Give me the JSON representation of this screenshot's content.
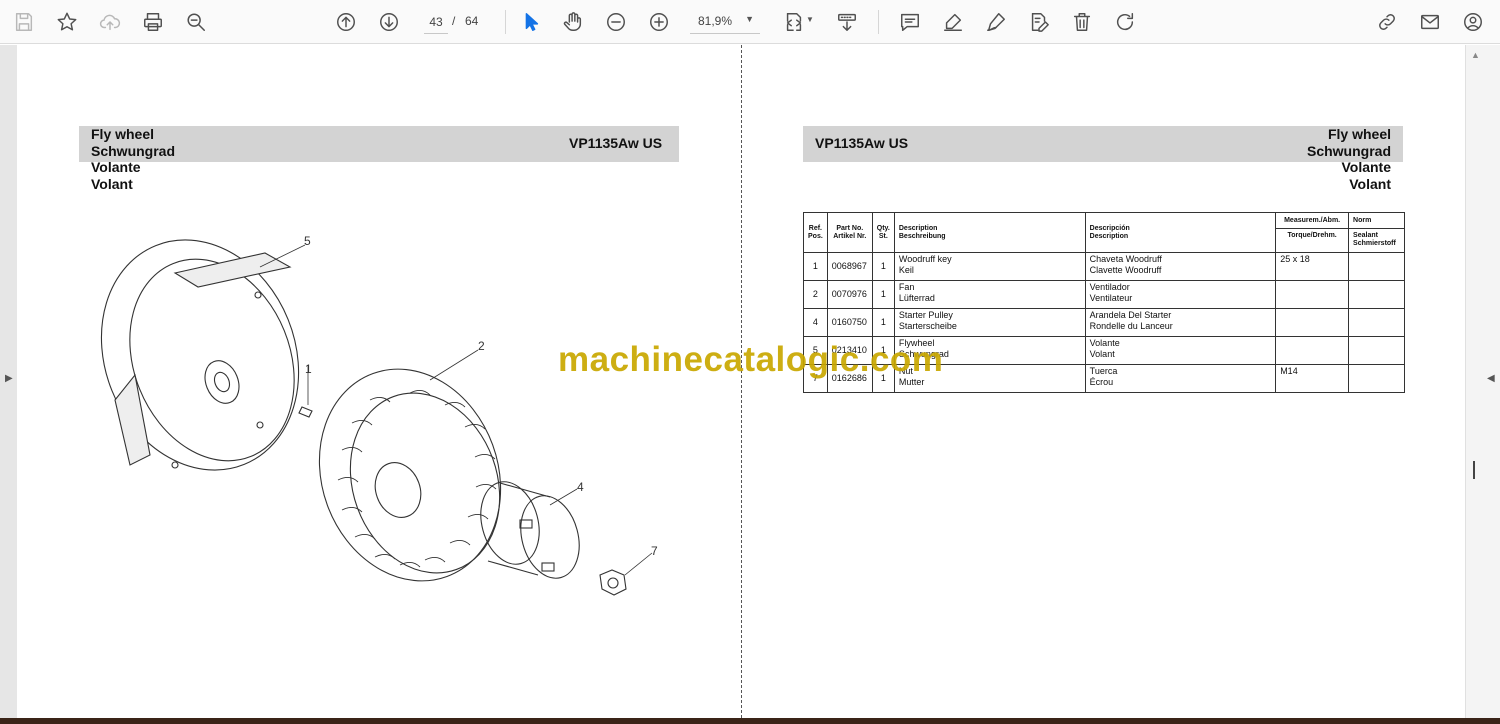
{
  "toolbar": {
    "icons": [
      "save-icon",
      "star-icon",
      "upload-cloud-icon",
      "print-icon",
      "zoom-search-icon",
      "page-up-icon",
      "page-down-icon",
      "cursor-icon",
      "hand-icon",
      "zoom-out-icon",
      "zoom-in-icon",
      "fit-page-icon",
      "scroll-mode-icon",
      "comment-icon",
      "highlight-icon",
      "sign-icon",
      "edit-text-icon",
      "delete-icon",
      "rotate-icon",
      "share-link-icon",
      "email-icon",
      "account-icon"
    ],
    "current_page": "43",
    "page_separator": "/",
    "total_pages": "64",
    "zoom": "81,9%"
  },
  "left_page": {
    "title_lines": [
      "Fly wheel",
      "Schwungrad",
      "Volante",
      "Volant"
    ],
    "model": "VP1135Aw US",
    "callouts": [
      "5",
      "2",
      "1",
      "4",
      "7"
    ]
  },
  "right_page": {
    "model": "VP1135Aw US",
    "title_lines": [
      "Fly wheel",
      "Schwungrad",
      "Volante",
      "Volant"
    ],
    "table": {
      "headers": {
        "ref": [
          "Ref.",
          "Pos."
        ],
        "part": [
          "Part No.",
          "Artikel Nr."
        ],
        "qty": [
          "Qty.",
          "St."
        ],
        "desc": [
          "Description",
          "Beschreibung"
        ],
        "desc2": [
          "Descripción",
          "Description"
        ],
        "measure": "Measurem./Abm.",
        "measure_sub": "Torque/Drehm.",
        "norm": "Norm",
        "norm_sub": [
          "Sealant",
          "Schmierstoff"
        ]
      },
      "rows": [
        {
          "ref": "1",
          "part": "0068967",
          "qty": "1",
          "desc": [
            "Woodruff key",
            "Keil"
          ],
          "desc2": [
            "Chaveta Woodruff",
            "Clavette Woodruff"
          ],
          "measure": "25 x 18",
          "norm": ""
        },
        {
          "ref": "2",
          "part": "0070976",
          "qty": "1",
          "desc": [
            "Fan",
            "Lüfterrad"
          ],
          "desc2": [
            "Ventilador",
            "Ventilateur"
          ],
          "measure": "",
          "norm": ""
        },
        {
          "ref": "4",
          "part": "0160750",
          "qty": "1",
          "desc": [
            "Starter Pulley",
            "Starterscheibe"
          ],
          "desc2": [
            "Arandela Del Starter",
            "Rondelle du Lanceur"
          ],
          "measure": "",
          "norm": ""
        },
        {
          "ref": "5",
          "part": "0213410",
          "qty": "1",
          "desc": [
            "Flywheel",
            "Schwungrad"
          ],
          "desc2": [
            "Volante",
            "Volant"
          ],
          "measure": "",
          "norm": ""
        },
        {
          "ref": "7",
          "part": "0162686",
          "qty": "1",
          "desc": [
            "Nut",
            "Mutter"
          ],
          "desc2": [
            "Tuerca",
            "Écrou"
          ],
          "measure": "M14",
          "norm": ""
        }
      ]
    }
  },
  "watermark": "machinecatalogic.com"
}
